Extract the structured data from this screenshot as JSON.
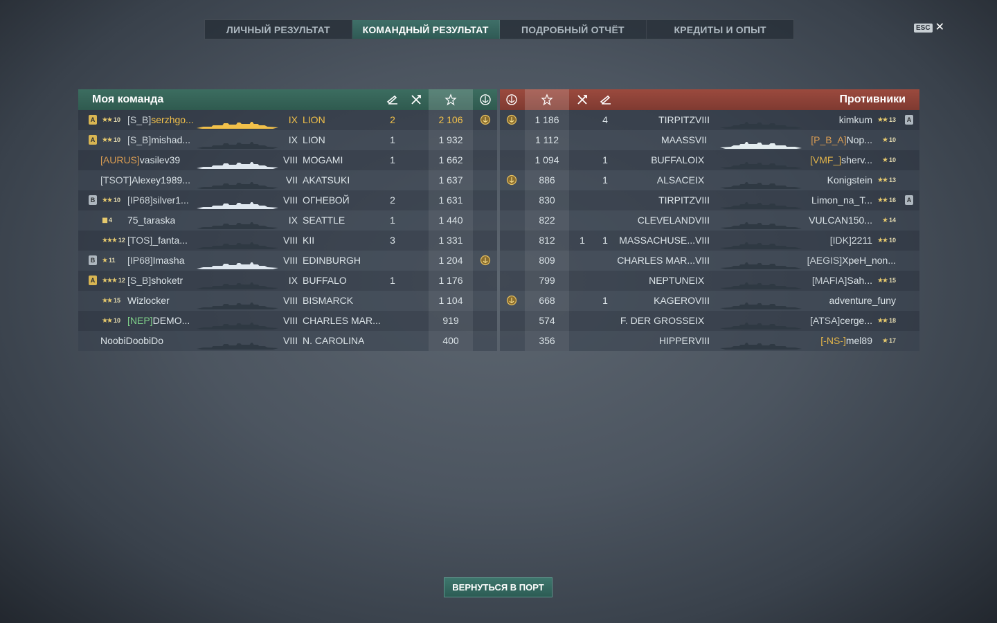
{
  "tabs": [
    {
      "label": "ЛИЧНЫЙ РЕЗУЛЬТАТ",
      "active": false
    },
    {
      "label": "КОМАНДНЫЙ РЕЗУЛЬТАТ",
      "active": true
    },
    {
      "label": "ПОДРОБНЫЙ ОТЧЁТ",
      "active": false
    },
    {
      "label": "КРЕДИТЫ И ОПЫТ",
      "active": false
    }
  ],
  "close": {
    "key": "ESC",
    "glyph": "✕"
  },
  "my_team": {
    "title": "Моя команда",
    "header_icons": [
      "torpedo-icon",
      "kills-icon",
      "xp-star-icon",
      "base-capture-icon"
    ],
    "rows": [
      {
        "division": "A",
        "rank_stars": "★★",
        "rank": "10",
        "clan": "[S_B]",
        "clan_style": "",
        "name": "serzhgo...",
        "tier": "IX",
        "ship": "LION",
        "kills": "2",
        "xp": "2 106",
        "medal": true,
        "self": true
      },
      {
        "division": "A",
        "rank_stars": "★★",
        "rank": "10",
        "clan": "[S_B]",
        "clan_style": "",
        "name": "mishad...",
        "tier": "IX",
        "ship": "LION",
        "kills": "1",
        "xp": "1 932",
        "medal": false,
        "self": false
      },
      {
        "division": "",
        "rank_stars": "",
        "rank": "",
        "clan": "[AURUS]",
        "clan_style": "orange",
        "name": "vasilev39",
        "tier": "VIII",
        "ship": "MOGAMI",
        "kills": "1",
        "xp": "1 662",
        "medal": false,
        "self": false
      },
      {
        "division": "",
        "rank_stars": "",
        "rank": "",
        "clan": "[TSOT]",
        "clan_style": "",
        "name": "Alexey1989...",
        "tier": "VII",
        "ship": "AKATSUKI",
        "kills": "",
        "xp": "1 637",
        "medal": false,
        "self": false
      },
      {
        "division": "B",
        "rank_stars": "★★",
        "rank": "10",
        "clan": "[IP68]",
        "clan_style": "",
        "name": "silver1...",
        "tier": "VIII",
        "ship": "ОГНЕВОЙ",
        "kills": "2",
        "xp": "1 631",
        "medal": false,
        "self": false
      },
      {
        "division": "",
        "rank_stars": "▮▮",
        "rank": "4",
        "clan": "",
        "clan_style": "",
        "name": "75_taraska",
        "tier": "IX",
        "ship": "SEATTLE",
        "kills": "1",
        "xp": "1 440",
        "medal": false,
        "self": false
      },
      {
        "division": "",
        "rank_stars": "★★★",
        "rank": "12",
        "clan": "[TOS]",
        "clan_style": "",
        "name": "_fanta...",
        "tier": "VIII",
        "ship": "KII",
        "kills": "3",
        "xp": "1 331",
        "medal": false,
        "self": false
      },
      {
        "division": "B",
        "rank_stars": "★",
        "rank": "11",
        "clan": "[IP68]",
        "clan_style": "",
        "name": "Imasha",
        "tier": "VIII",
        "ship": "EDINBURGH",
        "kills": "",
        "xp": "1 204",
        "medal": true,
        "self": false
      },
      {
        "division": "A",
        "rank_stars": "★★★",
        "rank": "12",
        "clan": "[S_B]",
        "clan_style": "",
        "name": "shoketr",
        "tier": "IX",
        "ship": "BUFFALO",
        "kills": "1",
        "xp": "1 176",
        "medal": false,
        "self": false
      },
      {
        "division": "",
        "rank_stars": "★★",
        "rank": "15",
        "clan": "",
        "clan_style": "",
        "name": "Wizlocker",
        "tier": "VIII",
        "ship": "BISMARCK",
        "kills": "",
        "xp": "1 104",
        "medal": false,
        "self": false
      },
      {
        "division": "",
        "rank_stars": "★★",
        "rank": "10",
        "clan": "[NEP]",
        "clan_style": "green",
        "name": "DEMO...",
        "tier": "VIII",
        "ship": "CHARLES MAR...",
        "kills": "",
        "xp": "919",
        "medal": false,
        "self": false
      },
      {
        "division": "",
        "rank_stars": "",
        "rank": "",
        "clan": "",
        "clan_style": "",
        "name": "NoobiDoobiDo",
        "tier": "VIII",
        "ship": "N. CAROLINA",
        "kills": "",
        "xp": "400",
        "medal": false,
        "self": false
      }
    ]
  },
  "enemy_team": {
    "title": "Противники",
    "header_icons": [
      "base-capture-icon",
      "xp-star-icon",
      "kills-icon",
      "torpedo-icon"
    ],
    "rows": [
      {
        "medal": true,
        "xp": "1 186",
        "k1": "",
        "k2": "4",
        "ship": "TIRPITZ",
        "tier": "VIII",
        "clan": "",
        "clan_style": "",
        "name": "kimkum",
        "rank_stars": "★★",
        "rank": "13",
        "division": "A"
      },
      {
        "medal": false,
        "xp": "1 112",
        "k1": "",
        "k2": "",
        "ship": "MAASS",
        "tier": "VII",
        "clan": "[P_B_A]",
        "clan_style": "orange",
        "name": "Nop...",
        "rank_stars": "★",
        "rank": "10",
        "division": ""
      },
      {
        "medal": false,
        "xp": "1 094",
        "k1": "",
        "k2": "1",
        "ship": "BUFFALO",
        "tier": "IX",
        "clan": "[VMF_]",
        "clan_style": "gold",
        "name": "sherv...",
        "rank_stars": "★",
        "rank": "10",
        "division": ""
      },
      {
        "medal": true,
        "xp": "886",
        "k1": "",
        "k2": "1",
        "ship": "ALSACE",
        "tier": "IX",
        "clan": "",
        "clan_style": "",
        "name": "Konigstein",
        "rank_stars": "★★",
        "rank": "13",
        "division": ""
      },
      {
        "medal": false,
        "xp": "830",
        "k1": "",
        "k2": "",
        "ship": "TIRPITZ",
        "tier": "VIII",
        "clan": "",
        "clan_style": "",
        "name": "Limon_na_T...",
        "rank_stars": "★★",
        "rank": "16",
        "division": "A"
      },
      {
        "medal": false,
        "xp": "822",
        "k1": "",
        "k2": "",
        "ship": "CLEVELAND",
        "tier": "VIII",
        "clan": "",
        "clan_style": "",
        "name": "VULCAN150...",
        "rank_stars": "★",
        "rank": "14",
        "division": ""
      },
      {
        "medal": false,
        "xp": "812",
        "k1": "1",
        "k2": "1",
        "ship": "MASSACHUSE...",
        "tier": "VIII",
        "clan": "[IDK]",
        "clan_style": "",
        "name": "2211",
        "rank_stars": "★★",
        "rank": "10",
        "division": ""
      },
      {
        "medal": false,
        "xp": "809",
        "k1": "",
        "k2": "",
        "ship": "CHARLES MAR...",
        "tier": "VIII",
        "clan": "[AEGIS]",
        "clan_style": "",
        "name": "XpeH_non...",
        "rank_stars": "",
        "rank": "",
        "division": ""
      },
      {
        "medal": false,
        "xp": "799",
        "k1": "",
        "k2": "",
        "ship": "NEPTUNE",
        "tier": "IX",
        "clan": "[MAFIA]",
        "clan_style": "",
        "name": "Sah...",
        "rank_stars": "★★",
        "rank": "15",
        "division": ""
      },
      {
        "medal": true,
        "xp": "668",
        "k1": "",
        "k2": "1",
        "ship": "KAGERO",
        "tier": "VIII",
        "clan": "",
        "clan_style": "",
        "name": "adventure_funy",
        "rank_stars": "",
        "rank": "",
        "division": ""
      },
      {
        "medal": false,
        "xp": "574",
        "k1": "",
        "k2": "",
        "ship": "F. DER GROßE",
        "tier": "IX",
        "clan": "[ATSA]",
        "clan_style": "",
        "name": "cerge...",
        "rank_stars": "★★",
        "rank": "18",
        "division": ""
      },
      {
        "medal": false,
        "xp": "356",
        "k1": "",
        "k2": "",
        "ship": "HIPPER",
        "tier": "VIII",
        "clan": "[-NS-]",
        "clan_style": "gold",
        "name": "mel89",
        "rank_stars": "★",
        "rank": "17",
        "division": ""
      }
    ]
  },
  "return_button": "ВЕРНУТЬСЯ В ПОРТ"
}
